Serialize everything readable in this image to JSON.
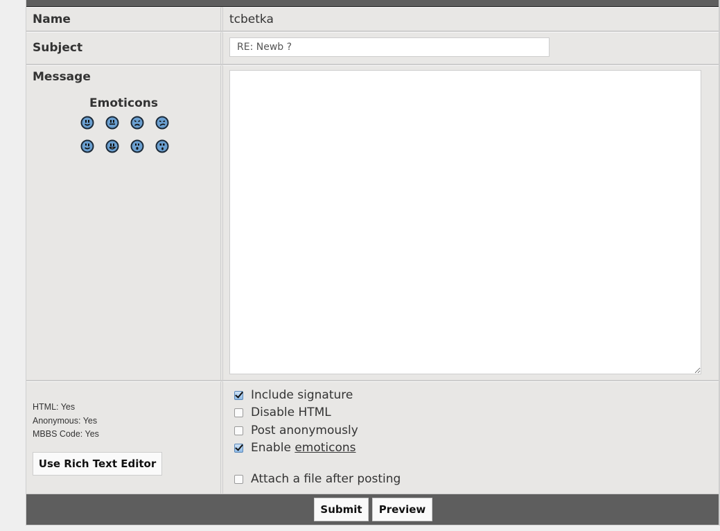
{
  "form": {
    "name_label": "Name",
    "name_value": "tcbetka",
    "subject_label": "Subject",
    "subject_value": "RE: Newb ?",
    "message_label": "Message",
    "message_value": "",
    "emoticons_title": "Emoticons",
    "emoticons": [
      {
        "icon": "smile-icon"
      },
      {
        "icon": "grin-icon"
      },
      {
        "icon": "sad-icon"
      },
      {
        "icon": "frown-icon"
      },
      {
        "icon": "wink-icon"
      },
      {
        "icon": "big-grin-icon"
      },
      {
        "icon": "surprised-icon"
      },
      {
        "icon": "shocked-icon"
      }
    ]
  },
  "info": {
    "html": "HTML: Yes",
    "anonymous": "Anonymous: Yes",
    "mbbs_code": "MBBS Code: Yes",
    "rich_text_button": "Use Rich Text Editor"
  },
  "options": {
    "include_signature": {
      "label": "Include signature",
      "checked": true
    },
    "disable_html": {
      "label": "Disable HTML",
      "checked": false
    },
    "post_anonymously": {
      "label": "Post anonymously",
      "checked": false
    },
    "enable_emoticons": {
      "label_prefix": "Enable ",
      "label_link": "emoticons",
      "checked": true
    },
    "attach_file": {
      "label": "Attach a file after posting",
      "checked": false
    }
  },
  "footer": {
    "submit_label": "Submit",
    "preview_label": "Preview"
  }
}
